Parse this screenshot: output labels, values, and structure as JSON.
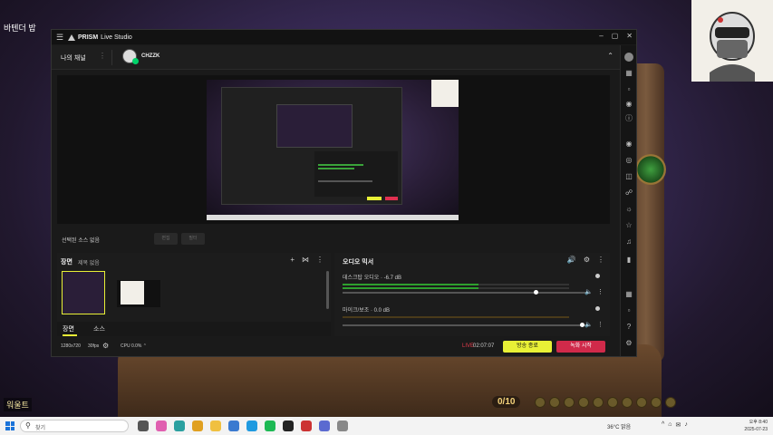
{
  "background": {
    "game_title": "바텐더 밥",
    "bottom_label": "워울트",
    "counter": "0/10"
  },
  "titlebar": {
    "app_name_bold": "PRISM",
    "app_name_rest": "Live Studio",
    "menu_icon": "hamburger-icon",
    "controls": [
      "–",
      "▢",
      "✕"
    ]
  },
  "channel_bar": {
    "label": "나의 채널",
    "channel_name": "CHZZK",
    "collapse_icon": "chevron-up-icon"
  },
  "selected_source": {
    "text": "선택된 소스 없음",
    "buttons": [
      "편집",
      "필터"
    ]
  },
  "scenes": {
    "header": "장면",
    "subheader": "제목 없음",
    "tabs": [
      "장면",
      "소스"
    ]
  },
  "mixer": {
    "header": "오디오 믹서",
    "channels": [
      {
        "name": "데스크탑 오디오",
        "level": "-6.7 dB",
        "meter": 0.6,
        "volume": 0.78
      },
      {
        "name": "마이크/보조",
        "level": "0.0 dB",
        "meter": 0.0,
        "volume": 0.97
      }
    ]
  },
  "status": {
    "resolution": "1280x720",
    "fps": "30fps",
    "cpu": "CPU 0.0%",
    "live_label": "LIVE",
    "elapsed": "02:07:07",
    "end_broadcast": "방송 종료",
    "start_recording": "녹화 시작"
  },
  "taskbar": {
    "search_placeholder": "찾기",
    "weather": "36°C 맑음",
    "tray_icons": [
      "^",
      "⌂",
      "✉",
      "♪"
    ],
    "time": "오후 8:40",
    "date": "2025-07-23"
  },
  "colors": {
    "accent_yellow": "#e8f036",
    "record_red": "#d02a4a",
    "live_red": "#e53b4c",
    "meter_green": "#2ea02e"
  }
}
